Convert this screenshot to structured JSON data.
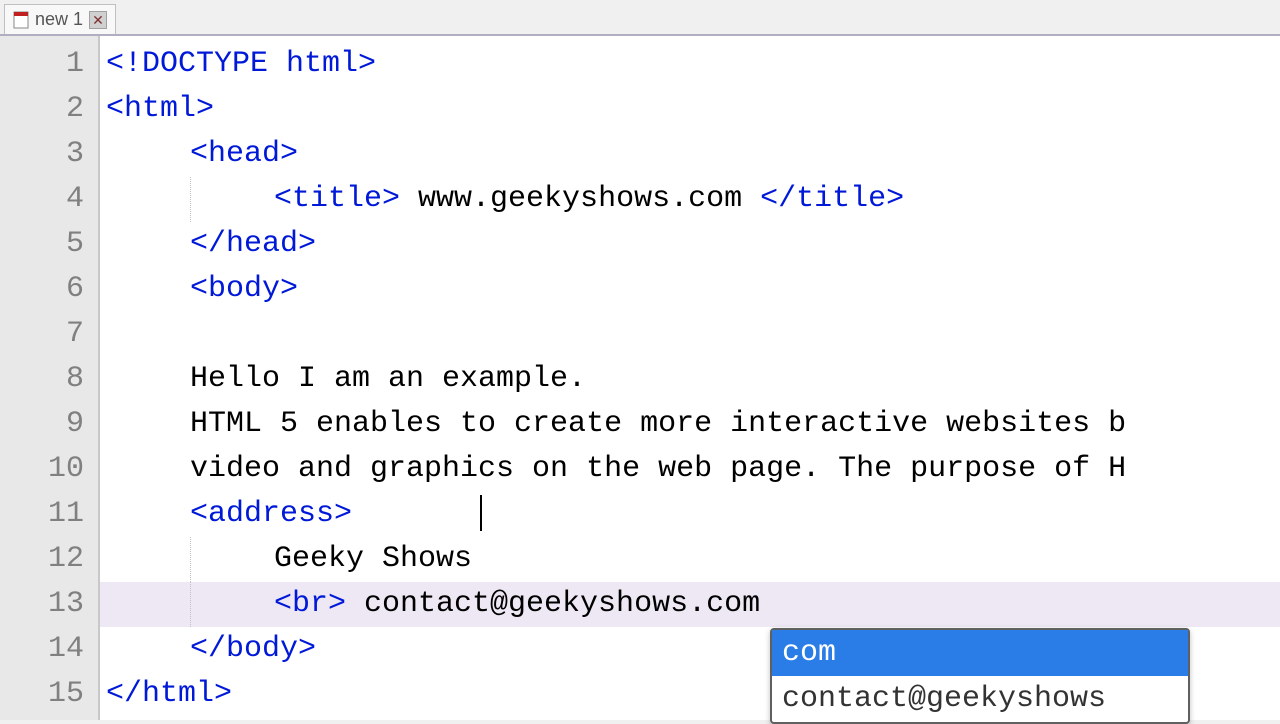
{
  "tab": {
    "label": "new 1"
  },
  "lines": [
    {
      "n": 1,
      "indent": 0,
      "segs": [
        {
          "t": "tag",
          "v": "<!DOCTYPE"
        },
        {
          "t": "txt",
          "v": " "
        },
        {
          "t": "tag",
          "v": "html>"
        }
      ]
    },
    {
      "n": 2,
      "indent": 0,
      "segs": [
        {
          "t": "tag",
          "v": "<html>"
        }
      ]
    },
    {
      "n": 3,
      "indent": 1,
      "segs": [
        {
          "t": "tag",
          "v": "<head>"
        }
      ]
    },
    {
      "n": 4,
      "indent": 2,
      "segs": [
        {
          "t": "tag",
          "v": "<title>"
        },
        {
          "t": "txt",
          "v": " www.geekyshows.com "
        },
        {
          "t": "tag",
          "v": "</title>"
        }
      ]
    },
    {
      "n": 5,
      "indent": 1,
      "segs": [
        {
          "t": "tag",
          "v": "</head>"
        }
      ]
    },
    {
      "n": 6,
      "indent": 1,
      "segs": [
        {
          "t": "tag",
          "v": "<body>"
        }
      ]
    },
    {
      "n": 7,
      "indent": 1,
      "segs": []
    },
    {
      "n": 8,
      "indent": 1,
      "segs": [
        {
          "t": "txt",
          "v": "Hello I am an example."
        }
      ]
    },
    {
      "n": 9,
      "indent": 1,
      "segs": [
        {
          "t": "txt",
          "v": "HTML 5 enables to create more interactive websites b"
        }
      ]
    },
    {
      "n": 10,
      "indent": 1,
      "segs": [
        {
          "t": "txt",
          "v": "video and graphics on the web page. The purpose of H"
        }
      ]
    },
    {
      "n": 11,
      "indent": 1,
      "segs": [
        {
          "t": "tag",
          "v": "<address>"
        }
      ],
      "caret": true
    },
    {
      "n": 12,
      "indent": 2,
      "segs": [
        {
          "t": "txt",
          "v": "Geeky Shows"
        }
      ]
    },
    {
      "n": 13,
      "indent": 2,
      "segs": [
        {
          "t": "tag",
          "v": "<br>"
        },
        {
          "t": "txt",
          "v": " contact@geekyshows.com"
        }
      ],
      "highlight": true
    },
    {
      "n": 14,
      "indent": 1,
      "segs": [
        {
          "t": "tag",
          "v": "</body>"
        }
      ]
    },
    {
      "n": 15,
      "indent": 0,
      "segs": [
        {
          "t": "tag",
          "v": "</html>"
        }
      ]
    }
  ],
  "autocomplete": {
    "items": [
      {
        "label": "com",
        "selected": true
      },
      {
        "label": "contact@geekyshows",
        "selected": false
      }
    ]
  }
}
